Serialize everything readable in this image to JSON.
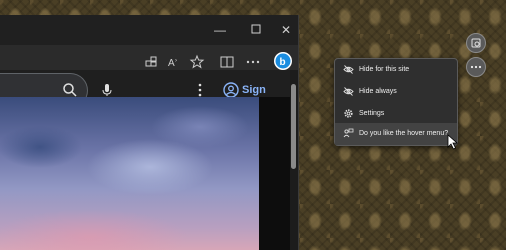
{
  "browser": {
    "window_controls": {
      "minimize_icon": "minimize-icon",
      "maximize_icon": "maximize-icon",
      "close_icon": "close-icon"
    },
    "toolbar_icons": [
      "extensions-icon",
      "read-aloud-icon",
      "favorites-icon",
      "split-screen-icon",
      "more-icon",
      "bing-copilot-icon"
    ],
    "page": {
      "signin_label": "Sign in"
    }
  },
  "hover_menu": {
    "items": [
      {
        "label": "Hide for this site",
        "icon": "eye-slash-icon"
      },
      {
        "label": "Hide always",
        "icon": "eye-slash-icon"
      },
      {
        "label": "Settings",
        "icon": "gear-icon"
      },
      {
        "label": "Do you like the hover menu?",
        "icon": "feedback-icon"
      }
    ]
  },
  "colors": {
    "accent": "#8ab4f8",
    "bing": "#1b8de0"
  }
}
